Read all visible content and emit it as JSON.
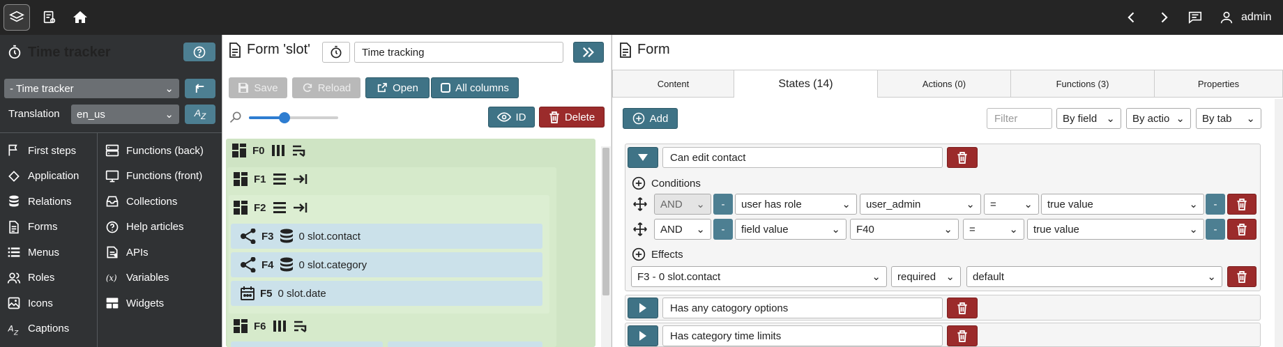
{
  "topbar": {
    "user": "admin"
  },
  "sidebar": {
    "title": "Time tracker",
    "app_select": "- Time tracker",
    "translation_label": "Translation",
    "translation_select": "en_us",
    "nav_left": [
      "First steps",
      "Application",
      "Relations",
      "Forms",
      "Menus",
      "Roles",
      "Icons",
      "Captions"
    ],
    "nav_right": [
      "Functions (back)",
      "Functions (front)",
      "Collections",
      "Help articles",
      "APIs",
      "Variables",
      "Widgets"
    ]
  },
  "form_panel": {
    "title": "Form 'slot'",
    "name_input": "Time tracking",
    "buttons": {
      "save": "Save",
      "reload": "Reload",
      "open": "Open",
      "all_columns": "All columns",
      "id": "ID",
      "delete": "Delete"
    },
    "zoom_percent": 40,
    "fields": {
      "f0": "F0",
      "f1": "F1",
      "f2": "F2",
      "f3": "F3",
      "f3_name": "0 slot.contact",
      "f4": "F4",
      "f4_name": "0 slot.category",
      "f5": "F5",
      "f5_name": "0 slot.date",
      "f6": "F6"
    }
  },
  "right_panel": {
    "title": "Form",
    "tabs": [
      "Content",
      "States (14)",
      "Actions (0)",
      "Functions (3)",
      "Properties"
    ],
    "add_label": "Add",
    "filter_placeholder": "Filter",
    "by_field": "By field",
    "by_action": "By actio",
    "by_tab": "By tab",
    "states": [
      {
        "name": "Can edit contact",
        "conditions_label": "Conditions",
        "conditions": [
          {
            "connector": "AND",
            "type": "user has role",
            "value": "user_admin",
            "op": "=",
            "result": "true value"
          },
          {
            "connector": "AND",
            "type": "field value",
            "value": "F40",
            "op": "=",
            "result": "true value"
          }
        ],
        "effects_label": "Effects",
        "effect": {
          "target": "F3 - 0 slot.contact",
          "state": "required",
          "value": "default"
        }
      },
      {
        "name": "Has any catogory options"
      },
      {
        "name": "Has category time limits"
      }
    ],
    "minus": "-"
  }
}
